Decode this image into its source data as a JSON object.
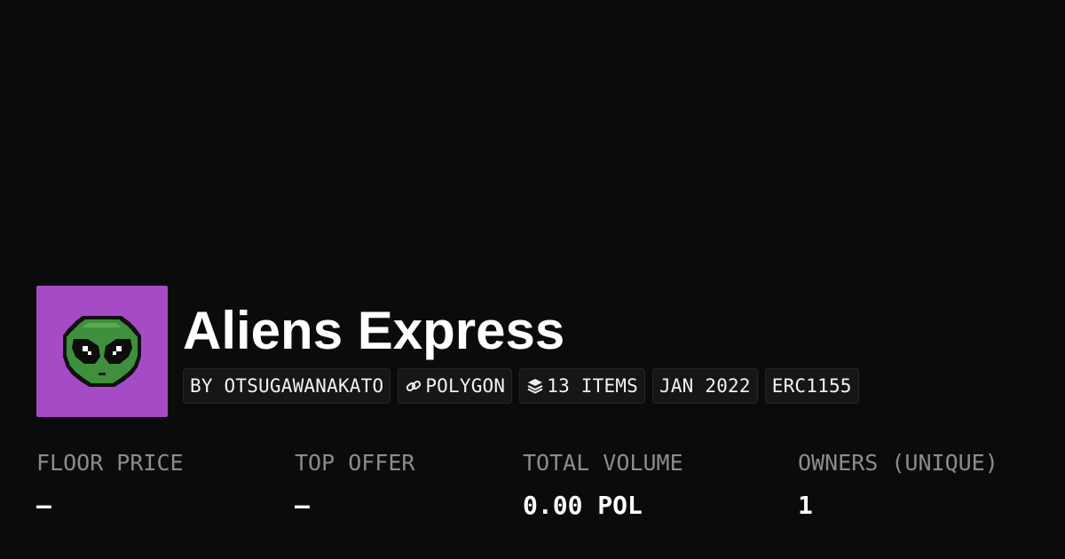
{
  "collection": {
    "name": "Aliens Express",
    "avatar_icon": "alien-head-icon",
    "avatar_bg": "#a64bc6"
  },
  "pills": {
    "creator": "BY OTSUGAWANAKATO",
    "chain": "POLYGON",
    "chain_icon": "link-icon",
    "items": "13 ITEMS",
    "items_icon": "layers-icon",
    "date": "JAN 2022",
    "standard": "ERC1155"
  },
  "stats": {
    "floor_price": {
      "label": "FLOOR PRICE",
      "value": "–"
    },
    "top_offer": {
      "label": "TOP OFFER",
      "value": "–"
    },
    "total_volume": {
      "label": "TOTAL VOLUME",
      "value": "0.00 POL"
    },
    "owners": {
      "label": "OWNERS (UNIQUE)",
      "value": "1"
    }
  }
}
